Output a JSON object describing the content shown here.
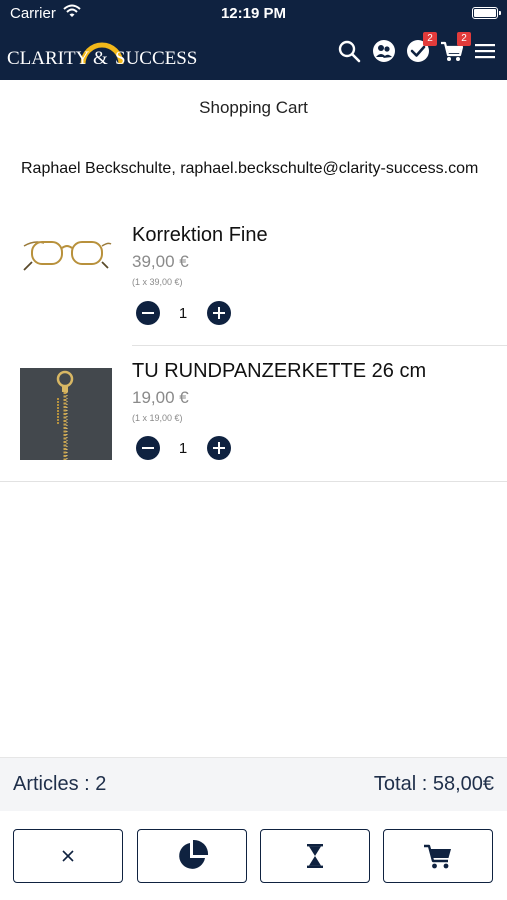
{
  "status_bar": {
    "carrier": "Carrier",
    "time": "12:19 PM",
    "wifi_icon": "wifi-icon",
    "battery_icon": "battery-icon"
  },
  "header": {
    "logo": {
      "word1": "CLARITY",
      "ampersand": "&",
      "word2": "SUCCESS"
    },
    "icons": [
      {
        "name": "search-icon"
      },
      {
        "name": "account-icon"
      },
      {
        "name": "checklist-icon",
        "badge": "2"
      },
      {
        "name": "cart-icon",
        "badge": "2"
      },
      {
        "name": "menu-icon"
      }
    ],
    "background_color": "#0f2240",
    "badge_color": "#e23b3b",
    "logo_arc_color": "#f2b81a"
  },
  "page": {
    "title": "Shopping Cart",
    "customer": "Raphael Beckschulte, raphael.beckschulte@clarity-success.com"
  },
  "cart": {
    "items": [
      {
        "name": "Korrektion Fine",
        "price": "39,00 €",
        "unit_price": "(1 x 39,00 €)",
        "quantity": "1",
        "image": "glasses-image"
      },
      {
        "name": "TU RUNDPANZERKETTE 26 cm",
        "price": "19,00 €",
        "unit_price": "(1 x 19,00 €)",
        "quantity": "1",
        "image": "chain-image"
      }
    ]
  },
  "summary": {
    "articles": "Articles : 2",
    "total": "Total : 58,00€"
  },
  "actions": [
    {
      "name": "close-icon"
    },
    {
      "name": "pie-chart-icon"
    },
    {
      "name": "hourglass-icon"
    },
    {
      "name": "cart-icon"
    }
  ],
  "accent_color": "#0f2240"
}
